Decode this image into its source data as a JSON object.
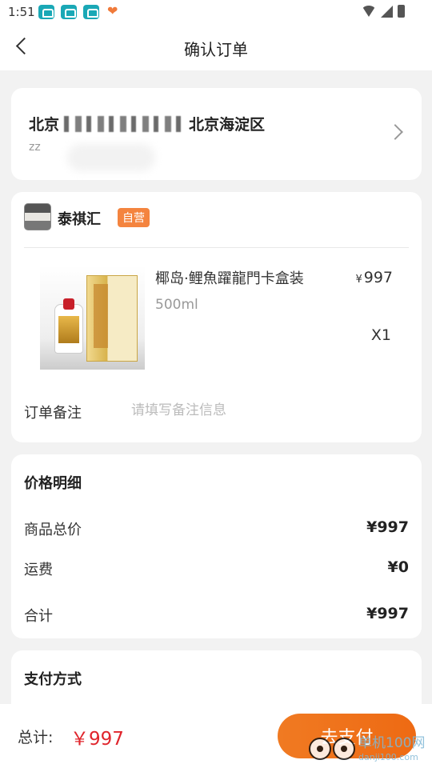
{
  "status_bar": {
    "time": "1:51"
  },
  "nav": {
    "title": "确认订单"
  },
  "address": {
    "city": "北京",
    "district": "北京海淀区",
    "name": "zz"
  },
  "store": {
    "name": "泰祺汇",
    "badge": "自营"
  },
  "product": {
    "name": "椰岛·鲤魚躍龍門卡盒装",
    "spec": "500ml",
    "currency": "¥",
    "price": "997",
    "quantity": "X1"
  },
  "note": {
    "label": "订单备注",
    "placeholder": "请填写备注信息"
  },
  "price_detail": {
    "title": "价格明细",
    "rows": [
      {
        "label": "商品总价",
        "value": "¥997"
      },
      {
        "label": "运费",
        "value": "¥0"
      },
      {
        "label": "合计",
        "value": "¥997"
      }
    ]
  },
  "payment": {
    "title": "支付方式"
  },
  "bottom": {
    "total_label": "总计:",
    "total_value": "￥997",
    "pay_button": "去支付"
  },
  "watermark": {
    "text": "单机100网",
    "sub": "danji100.com"
  }
}
